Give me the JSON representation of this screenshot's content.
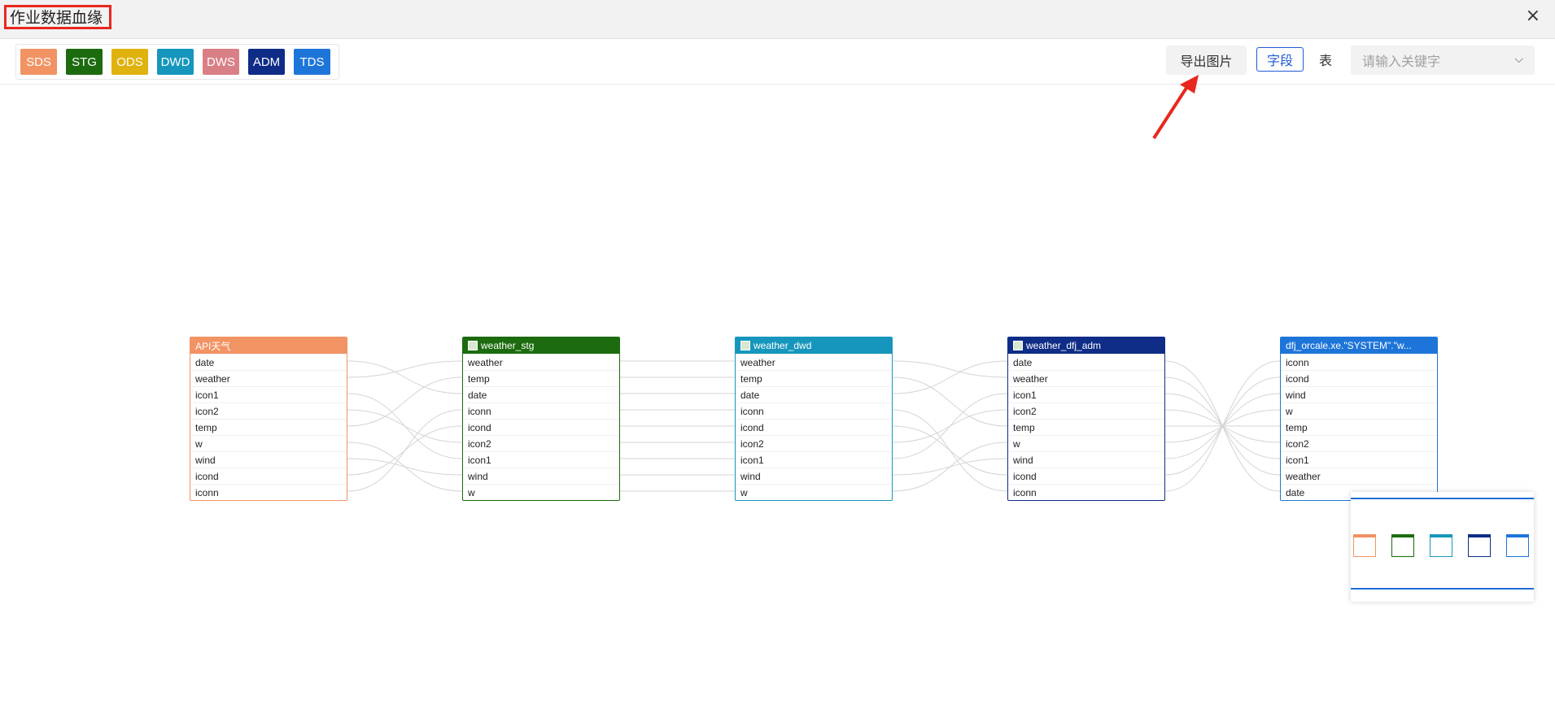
{
  "window": {
    "title": "作业数据血缘",
    "close_icon": "×"
  },
  "legend": [
    {
      "label": "SDS",
      "color": "#f19363"
    },
    {
      "label": "STG",
      "color": "#1c6b0f"
    },
    {
      "label": "ODS",
      "color": "#e0b20d"
    },
    {
      "label": "DWD",
      "color": "#1696bc"
    },
    {
      "label": "DWS",
      "color": "#d97f86"
    },
    {
      "label": "ADM",
      "color": "#0f2c87"
    },
    {
      "label": "TDS",
      "color": "#1e75d9"
    }
  ],
  "toolbar": {
    "export_label": "导出图片",
    "view_field": "字段",
    "view_table": "表",
    "search_placeholder": "请输入关键字",
    "chevron": "⌵"
  },
  "nodes": [
    {
      "title": "API天气",
      "color": "#f19363",
      "icon": false,
      "fields": [
        "date",
        "weather",
        "icon1",
        "icon2",
        "temp",
        "w",
        "wind",
        "icond",
        "iconn"
      ]
    },
    {
      "title": "weather_stg",
      "color": "#1c6b0f",
      "icon": true,
      "fields": [
        "weather",
        "temp",
        "date",
        "iconn",
        "icond",
        "icon2",
        "icon1",
        "wind",
        "w"
      ]
    },
    {
      "title": "weather_dwd",
      "color": "#1696bc",
      "icon": true,
      "fields": [
        "weather",
        "temp",
        "date",
        "iconn",
        "icond",
        "icon2",
        "icon1",
        "wind",
        "w"
      ]
    },
    {
      "title": "weather_dfj_adm",
      "color": "#0f2c87",
      "icon": true,
      "fields": [
        "date",
        "weather",
        "icon1",
        "icon2",
        "temp",
        "w",
        "wind",
        "icond",
        "iconn"
      ]
    },
    {
      "title": "dfj_orcale.xe.\"SYSTEM\".\"w...",
      "color": "#1e75d9",
      "icon": false,
      "fields": [
        "iconn",
        "icond",
        "wind",
        "w",
        "temp",
        "icon2",
        "icon1",
        "weather",
        "date"
      ]
    }
  ]
}
